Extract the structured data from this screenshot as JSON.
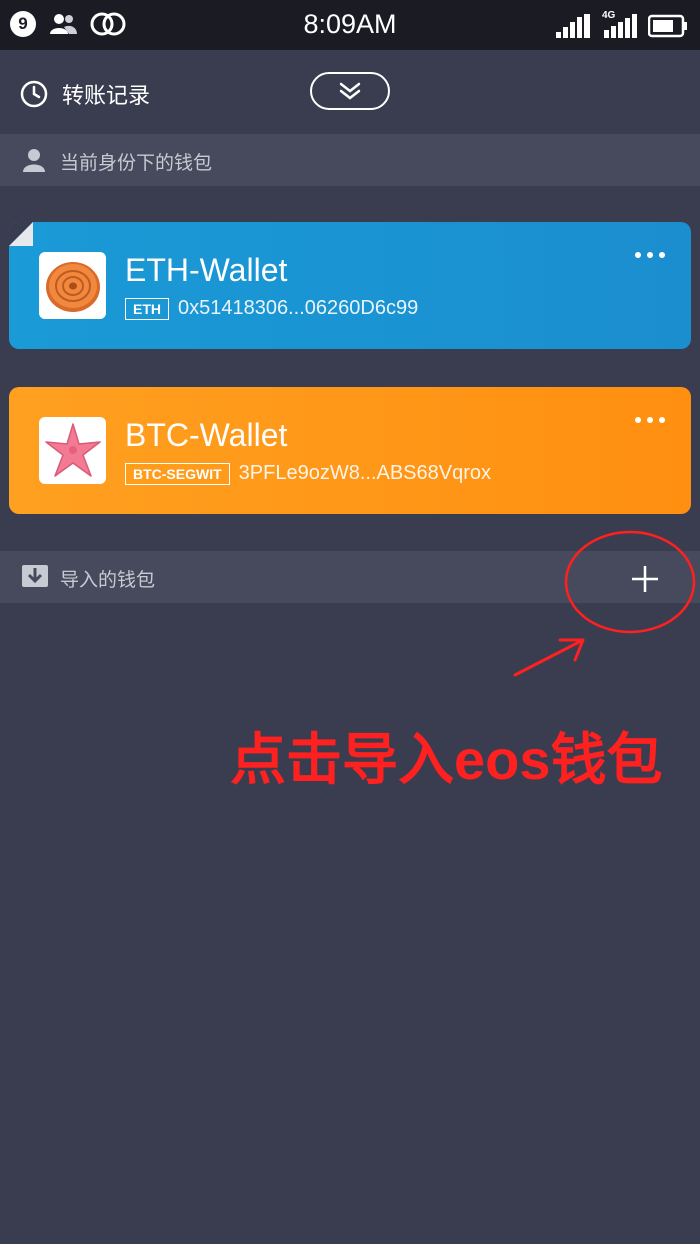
{
  "status_bar": {
    "badge_count": "9",
    "time": "8:09AM",
    "network_label": "4G"
  },
  "header": {
    "history_label": "转账记录"
  },
  "sections": {
    "identity_wallets": "当前身份下的钱包",
    "imported_wallets": "导入的钱包"
  },
  "wallets": [
    {
      "name": "ETH-Wallet",
      "chain": "ETH",
      "address": "0x51418306...06260D6c99",
      "color": "#1a9ad6",
      "logo_icon": "coin-icon"
    },
    {
      "name": "BTC-Wallet",
      "chain": "BTC-SEGWIT",
      "address": "3PFLe9ozW8...ABS68Vqrox",
      "color": "#ff9a18",
      "logo_icon": "starfish-icon"
    }
  ],
  "annotation": {
    "text": "点击导入eos钱包",
    "color": "#ff2020"
  }
}
